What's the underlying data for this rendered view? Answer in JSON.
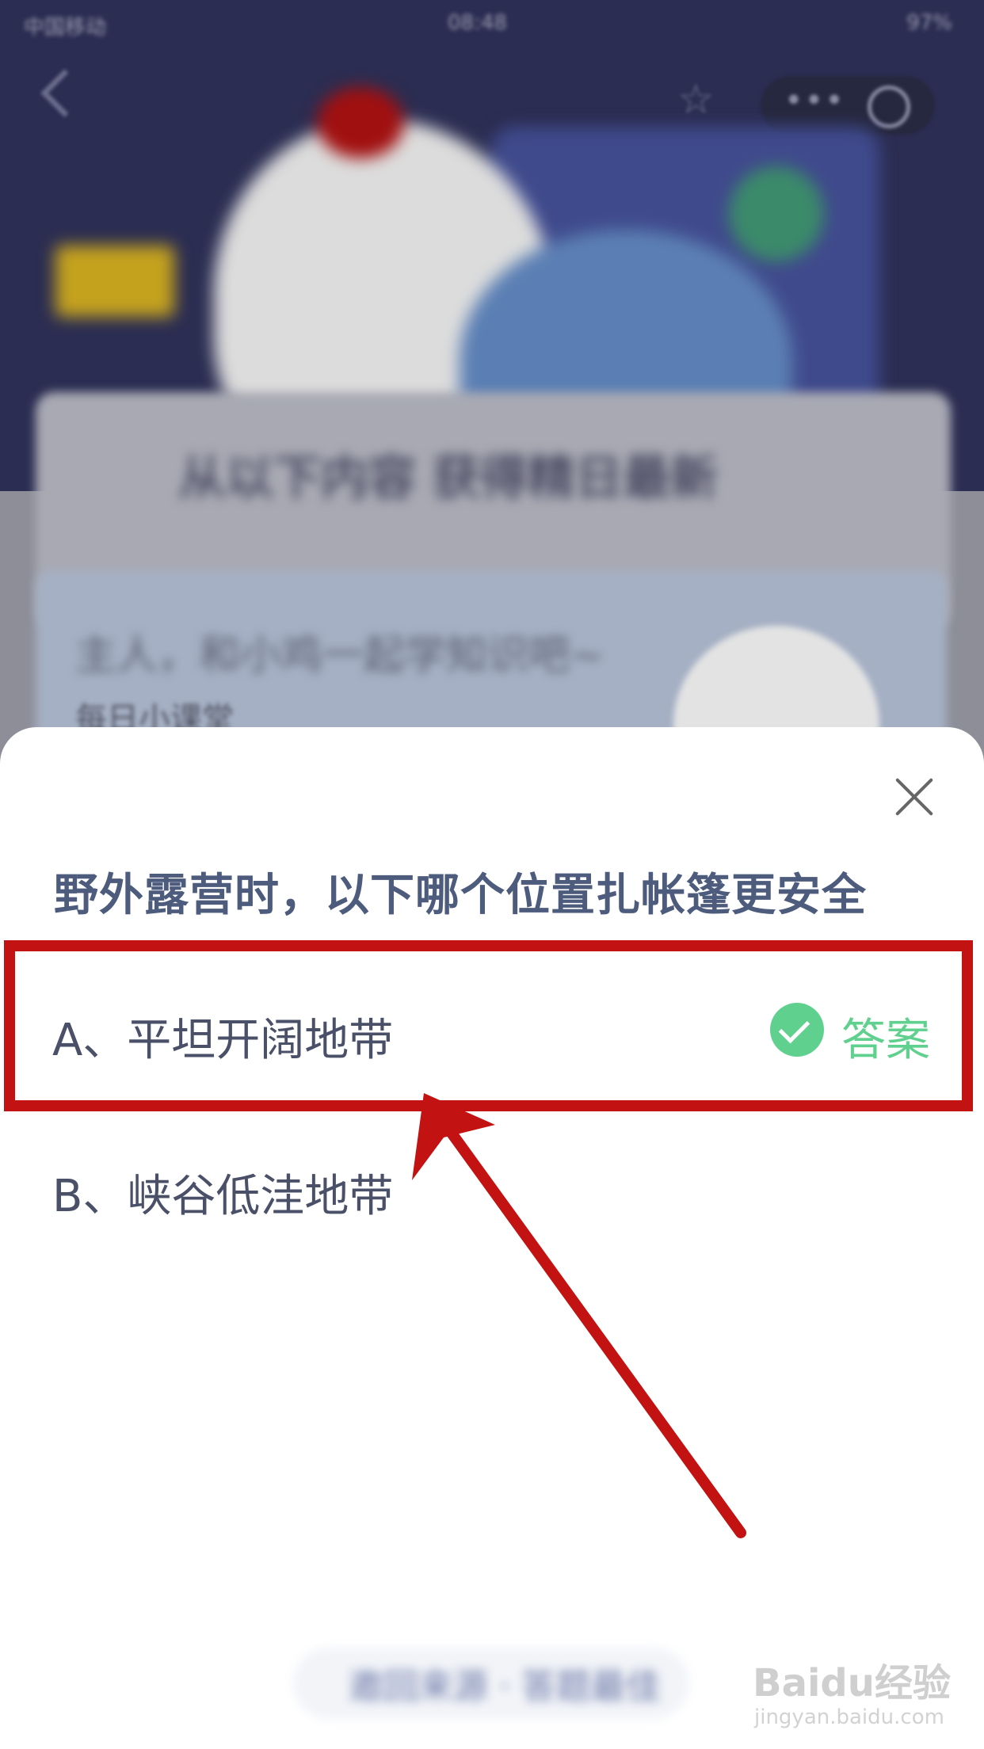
{
  "status_bar": {
    "carrier": "中国移动",
    "time": "08:48",
    "battery": "97%"
  },
  "background": {
    "banner_title": "从以下内容  获得精日最新",
    "tip_line1": "主人，和小鸡一起学知识吧~",
    "tip_line2": "每日小课堂",
    "bottom_button": "邀回来源 · 答题最佳"
  },
  "quiz": {
    "question": "野外露营时，以下哪个位置扎帐篷更安全",
    "options": [
      {
        "label": "A、平坦开阔地带",
        "is_answer": true,
        "answer_tag": "答案"
      },
      {
        "label": "B、峡谷低洼地带",
        "is_answer": false
      }
    ]
  },
  "annotation": {
    "box_color": "#c21212",
    "arrow_color": "#c21212"
  },
  "watermark": {
    "logo": "Baidu经验",
    "url": "jingyan.baidu.com"
  },
  "colors": {
    "answer_green": "#5fd08d",
    "question_text": "#4d5b7d"
  }
}
